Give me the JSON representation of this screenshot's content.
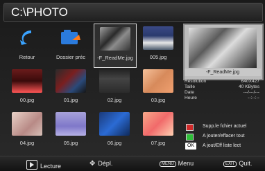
{
  "header": {
    "path": "C:\\PHOTO"
  },
  "grid": {
    "items": [
      {
        "label": "Retour",
        "kind": "back-icon"
      },
      {
        "label": "Dossier préc",
        "kind": "folder-up-icon"
      },
      {
        "label": "-F_ReadMe.jpg",
        "kind": "image",
        "selected": true
      },
      {
        "label": "005.jpg",
        "kind": "image"
      },
      {
        "label": "00.jpg",
        "kind": "image"
      },
      {
        "label": "01.jpg",
        "kind": "image"
      },
      {
        "label": "02.jpg",
        "kind": "image"
      },
      {
        "label": "03.jpg",
        "kind": "image"
      },
      {
        "label": "04.jpg",
        "kind": "image"
      },
      {
        "label": "05.jpg",
        "kind": "image"
      },
      {
        "label": "06.jpg",
        "kind": "image"
      },
      {
        "label": "07.jpg",
        "kind": "image"
      }
    ]
  },
  "preview": {
    "filename": "-F_ReadMe.jpg"
  },
  "info": {
    "rows": [
      {
        "key": "Résolution",
        "value": "640X427"
      },
      {
        "key": "Taille",
        "value": "40 KBytes"
      },
      {
        "key": "Date",
        "value": "---/---/---"
      },
      {
        "key": "Heure",
        "value": "--:--:--"
      }
    ]
  },
  "actions": [
    {
      "key_color": "#d12a2a",
      "label": "Supp.le fchier actuel"
    },
    {
      "key_color": "#2fbf3a",
      "label": "A jouter/effacer tout"
    },
    {
      "key_text": "OK",
      "label": "A jout/Eff liste lect"
    }
  ],
  "footer": {
    "play_label": "Lecture",
    "move_label": "Dépl.",
    "menu_key": "MENU",
    "menu_label": "Menu",
    "exit_key": "EXIT",
    "exit_label": "Quit."
  }
}
